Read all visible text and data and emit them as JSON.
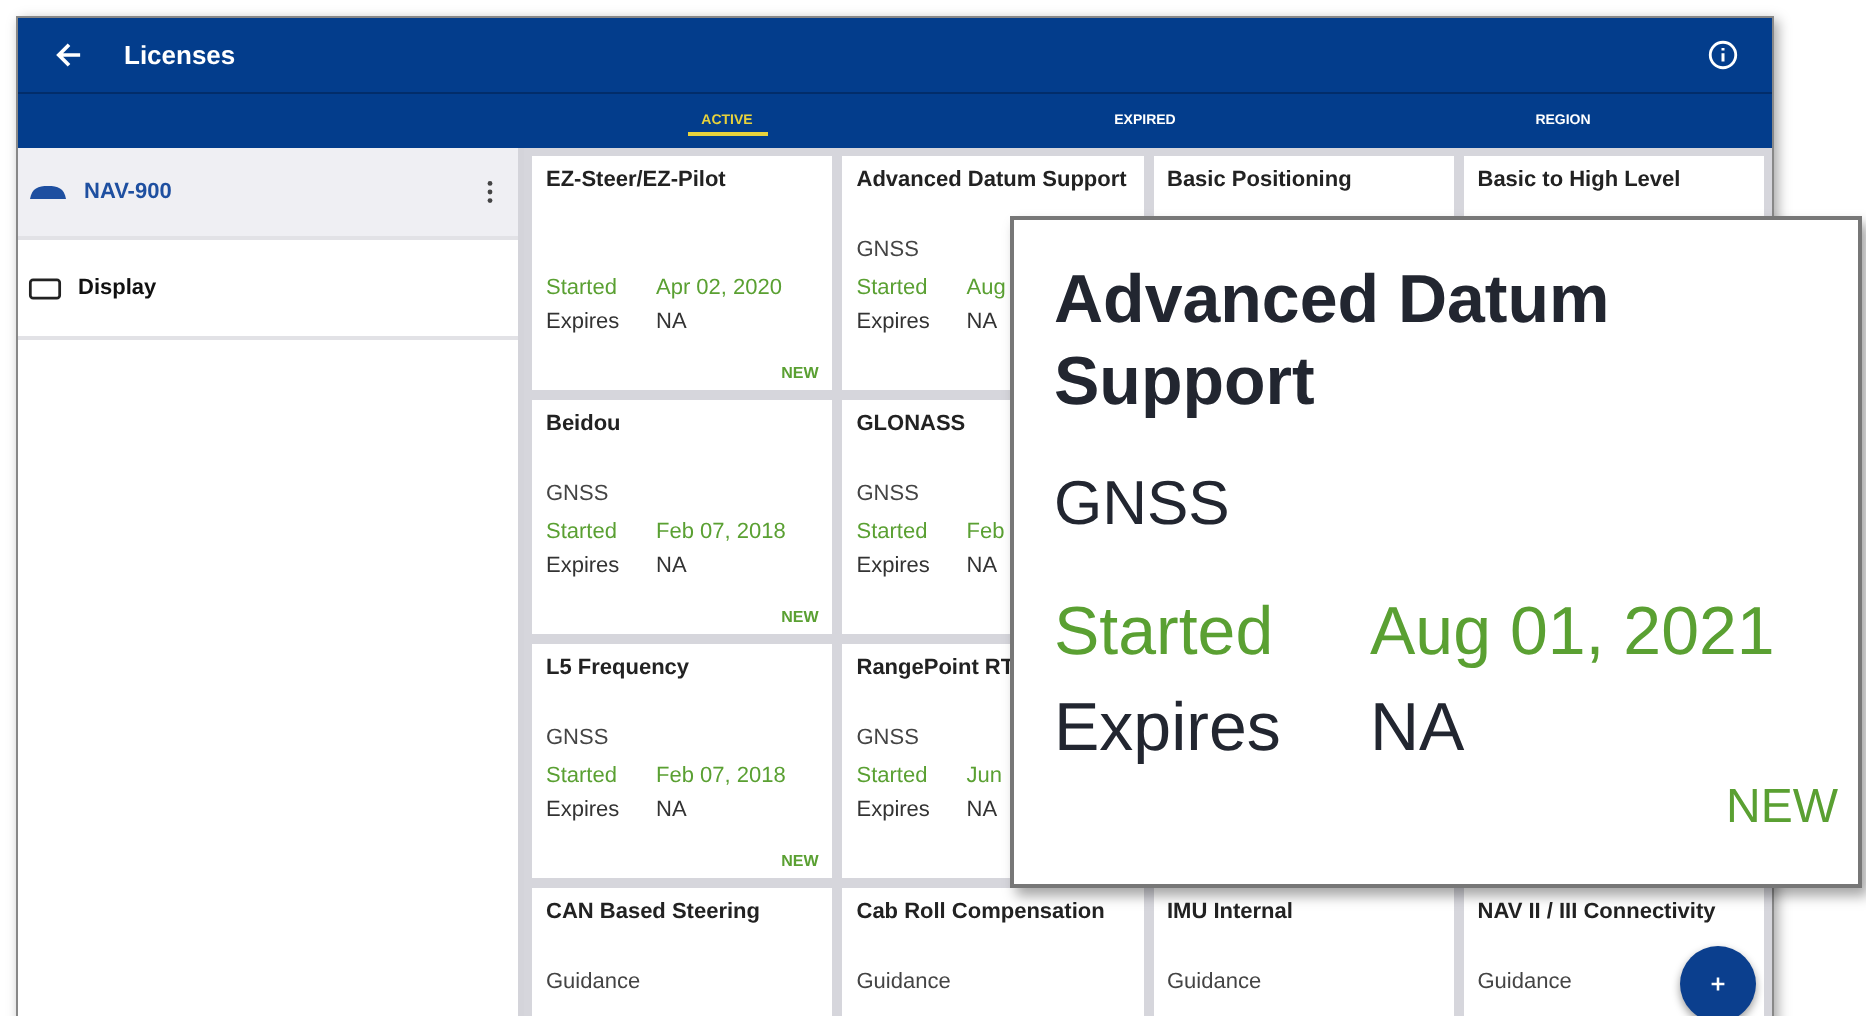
{
  "app_bar": {
    "title": "Licenses"
  },
  "tabs": [
    {
      "label": "ACTIVE",
      "selected": true
    },
    {
      "label": "EXPIRED",
      "selected": false
    },
    {
      "label": "REGION",
      "selected": false
    }
  ],
  "sidebar": {
    "items": [
      {
        "kind": "receiver",
        "label": "NAV-900",
        "selected": true
      },
      {
        "kind": "display",
        "label": "Display",
        "selected": false
      }
    ]
  },
  "card_rows": [
    [
      {
        "title": "EZ-Steer/EZ-Pilot",
        "started_label": "Started",
        "started": "Apr 02, 2020",
        "expires_label": "Expires",
        "expires": "NA",
        "badge": "NEW"
      },
      {
        "title": "Advanced Datum Support",
        "category": "GNSS",
        "started_label": "Started",
        "started": "Aug",
        "expires_label": "Expires",
        "expires": "NA"
      },
      {
        "title": "Basic Positioning"
      },
      {
        "title": "Basic to High Level"
      }
    ],
    [
      {
        "title": "Beidou",
        "category": "GNSS",
        "started_label": "Started",
        "started": "Feb 07, 2018",
        "expires_label": "Expires",
        "expires": "NA",
        "badge": "NEW"
      },
      {
        "title": "GLONASS",
        "category": "GNSS",
        "started_label": "Started",
        "started": "Feb",
        "expires_label": "Expires",
        "expires": "NA"
      }
    ],
    [
      {
        "title": "L5 Frequency",
        "category": "GNSS",
        "started_label": "Started",
        "started": "Feb 07, 2018",
        "expires_label": "Expires",
        "expires": "NA",
        "badge": "NEW"
      },
      {
        "title": "RangePoint RT",
        "category": "GNSS",
        "started_label": "Started",
        "started": "Jun",
        "expires_label": "Expires",
        "expires": "NA"
      }
    ],
    [
      {
        "title": "CAN Based Steering",
        "category": "Guidance"
      },
      {
        "title": "Cab Roll Compensation",
        "category": "Guidance"
      },
      {
        "title": "IMU Internal",
        "category": "Guidance"
      },
      {
        "title": "NAV II / III Connectivity",
        "category": "Guidance"
      }
    ]
  ],
  "callout": {
    "title": "Advanced Datum Support",
    "category": "GNSS",
    "started_label": "Started",
    "started": "Aug 01, 2021",
    "expires_label": "Expires",
    "expires": "NA",
    "badge": "NEW"
  }
}
